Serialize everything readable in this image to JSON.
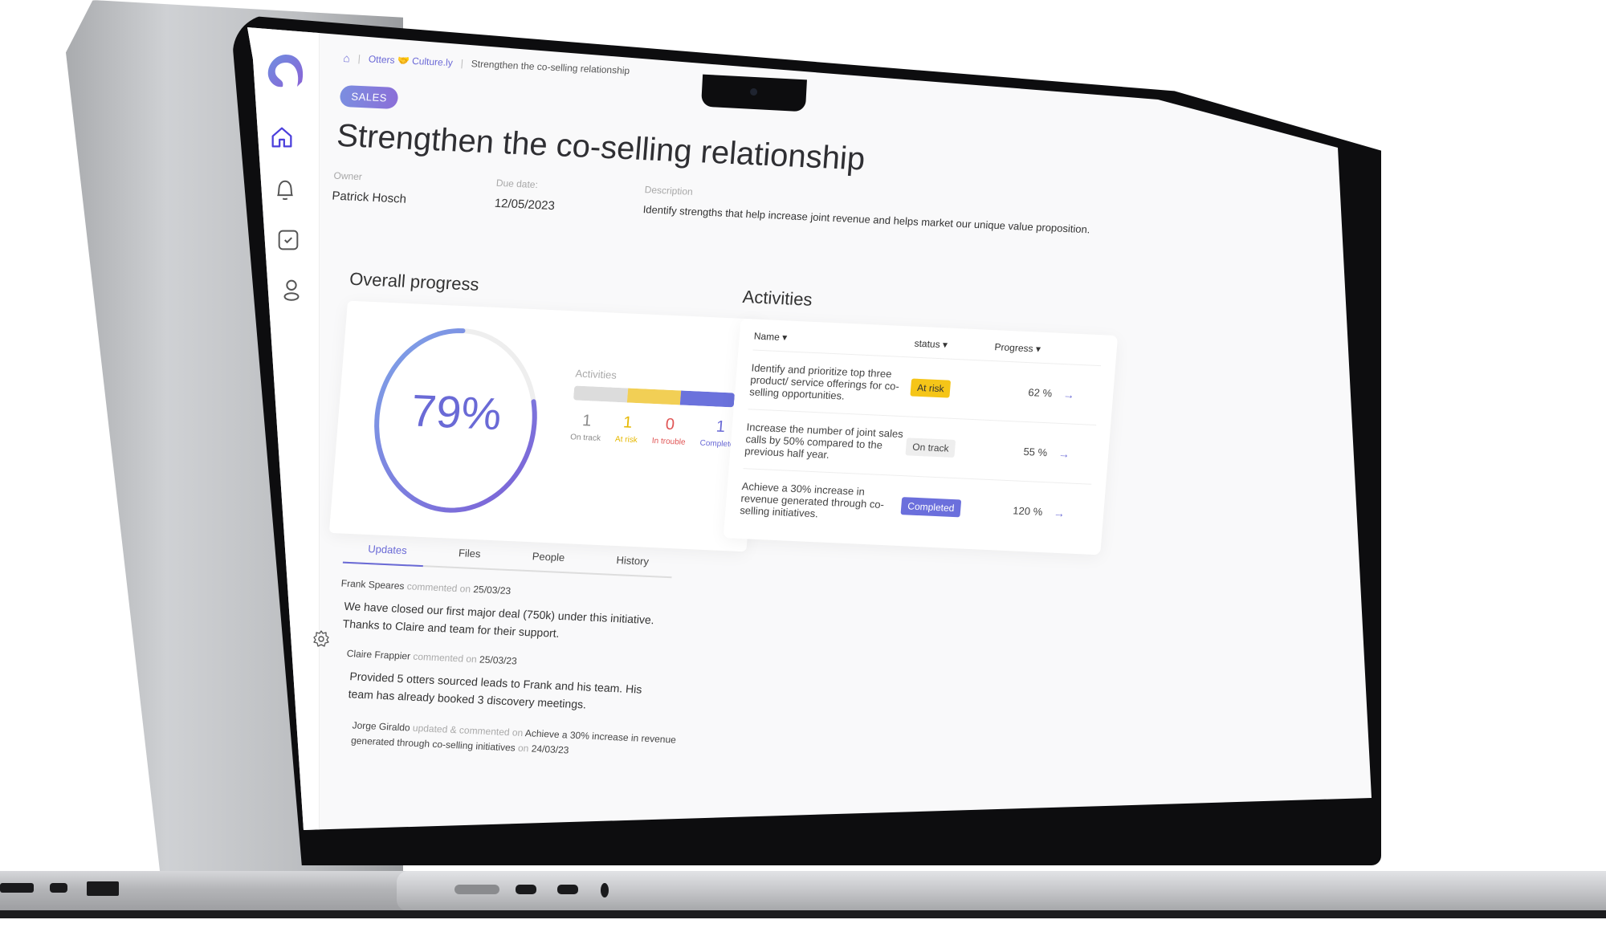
{
  "breadcrumb": {
    "home_icon": "home-icon",
    "org": "Otters 🤝 Culture.ly",
    "current": "Strengthen the co-selling relationship"
  },
  "sidebar": {
    "logo": "app-logo",
    "items": [
      {
        "icon": "home-icon",
        "active": true
      },
      {
        "icon": "bell-icon",
        "active": false
      },
      {
        "icon": "checkbox-icon",
        "active": false
      },
      {
        "icon": "user-icon",
        "active": false
      }
    ],
    "settings_icon": "gear-icon"
  },
  "initiative": {
    "tag": "SALES",
    "title": "Strengthen the co-selling relationship",
    "owner_label": "Owner",
    "owner": "Patrick Hosch",
    "due_label": "Due date:",
    "due": "12/05/2023",
    "description_label": "Description",
    "description": "Identify strengths that help increase joint revenue and helps market our unique value proposition."
  },
  "overall_progress": {
    "title": "Overall progress",
    "percent": 79,
    "percent_label": "79%",
    "activities_label": "Activities",
    "counts": [
      {
        "label": "On track",
        "value": "1",
        "color": "#8a8a8a",
        "bar_color": "#dcdcdc"
      },
      {
        "label": "At risk",
        "value": "1",
        "color": "#e6b800",
        "bar_color": "#f2cf55"
      },
      {
        "label": "In trouble",
        "value": "0",
        "color": "#e05555",
        "bar_color": "#e05555"
      },
      {
        "label": "Completed",
        "value": "1",
        "color": "#6a6ad6",
        "bar_color": "#6b72dc"
      }
    ]
  },
  "activities": {
    "title": "Activities",
    "columns": [
      "Name",
      "status",
      "Progress"
    ],
    "rows": [
      {
        "name": "Identify and prioritize top three product/ service offerings for co-selling opportunities.",
        "status": "At risk",
        "status_bg": "#f5c518",
        "status_fg": "#333333",
        "progress": "62 %"
      },
      {
        "name": "Increase the number of joint sales calls by 50% compared to the previous half year.",
        "status": "On track",
        "status_bg": "#eeeeee",
        "status_fg": "#444444",
        "progress": "55 %"
      },
      {
        "name": "Achieve a 30% increase in revenue generated through co-selling initiatives.",
        "status": "Completed",
        "status_bg": "#6b6fdc",
        "status_fg": "#ffffff",
        "progress": "120 %"
      }
    ]
  },
  "tabs": [
    "Updates",
    "Files",
    "People",
    "History"
  ],
  "updates": [
    {
      "author": "Frank Speares",
      "action": "commented on",
      "date": "25/03/23",
      "body": "We have closed our first major deal (750k) under this initiative. Thanks to Claire and team for their support."
    },
    {
      "author": "Claire Frappier",
      "action": "commented on",
      "date": "25/03/23",
      "body": "Provided 5 otters sourced leads to Frank and his team. His team has already booked 3 discovery meetings."
    },
    {
      "author": "Jorge Giraldo",
      "action": "updated & commented on",
      "target": "Achieve a 30% increase in revenue generated through co-selling initiatives",
      "on": "on",
      "date": "24/03/23"
    }
  ],
  "colors": {
    "accent": "#6a6ad6",
    "accent_gradient_start": "#7b9de6",
    "accent_gradient_end": "#8a6ad8"
  }
}
